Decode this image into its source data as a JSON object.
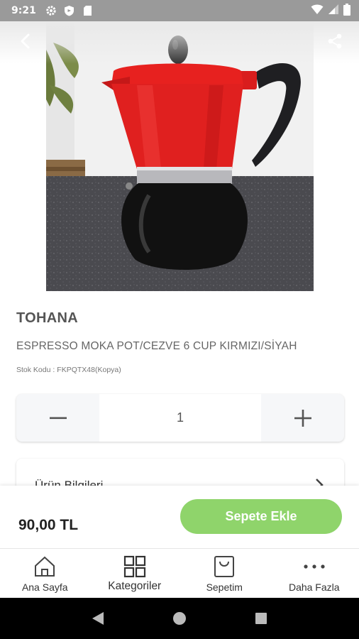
{
  "status_bar": {
    "time": "9:21"
  },
  "product": {
    "brand": "TOHANA",
    "name": "ESPRESSO MOKA POT/CEZVE 6 CUP KIRMIZI/SİYAH",
    "sku_label": "Stok Kodu :",
    "sku_value": "FKPQTX48(Kopya)",
    "quantity": "1",
    "price": "90,00 TL"
  },
  "info_card": {
    "label": "Ürün Bilgileri"
  },
  "actions": {
    "add_to_cart": "Sepete Ekle",
    "decrement": "−",
    "increment": "+"
  },
  "bottom_nav": [
    {
      "label": "Ana Sayfa",
      "icon": "home-icon"
    },
    {
      "label": "Kategoriler",
      "icon": "grid-icon"
    },
    {
      "label": "Sepetim",
      "icon": "bag-icon"
    },
    {
      "label": "Daha Fazla",
      "icon": "more-icon"
    }
  ],
  "colors": {
    "accent": "#8fd46b",
    "status_bar": "#9a9a9a",
    "pot_red": "#e0201f",
    "pot_black": "#111111"
  }
}
